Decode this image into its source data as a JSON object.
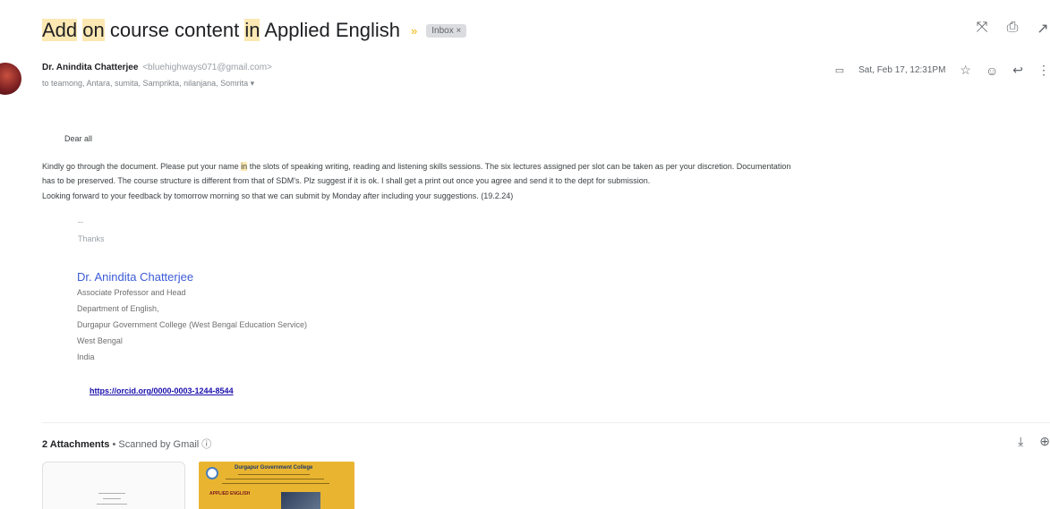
{
  "email": {
    "subject": {
      "part1": "Add",
      "part2": "on",
      "part3": "course content",
      "part4": "in",
      "part5": "Applied English",
      "label": "Inbox ×"
    },
    "sender": {
      "name": "Dr. Anindita Chatterjee",
      "email": "<bluehighways071@gmail.com>",
      "recipients": "to teamong, Antara, sumita, Samprikta, nilanjana, Somrita ▾"
    },
    "meta": {
      "date": "Sat, Feb 17, 12:31PM"
    },
    "body": {
      "greeting": "Dear all",
      "para1_a": "Kindly go through the document. Please put your name",
      "para1_hl": "in",
      "para1_b": "the  slots of speaking writing, reading and listening skills sessions. The six lectures assigned per slot can be taken as per your discretion. Documentation",
      "para2": "has to be preserved. The course structure is different from that of SDM's. Plz suggest if it is ok. I shall get a print out once you agree and send it to the dept for submission.",
      "para3": "Looking forward to your feedback by tomorrow morning so that we can submit by Monday after including your suggestions. (19.2.24)",
      "ellipsis": "--",
      "thanks": "Thanks"
    },
    "signature": {
      "name": "Dr. Anindita Chatterjee",
      "line1": "Associate Professor and Head",
      "line2": "Department of English,",
      "line3": "Durgapur Government College (West Bengal Education Service)",
      "line4": "West Bengal",
      "line5": "India",
      "orcid": "https://orcid.org/0000-0003-1244-8544"
    },
    "attachments": {
      "count_label": "2 Attachments",
      "separator": "•",
      "scan_label": "Scanned by Gmail ⓘ",
      "thumb2_title": "Durgapur Government College",
      "thumb2_subtitle": "APPLIED ENGLISH"
    }
  },
  "icons": {
    "close": "⤧",
    "print": "⎙",
    "open_new": "↗",
    "attachment": "▭",
    "star": "☆",
    "emoji": "☺",
    "reply": "↩",
    "more": "⋮",
    "download": "⤓",
    "add_drive": "⊕",
    "important": "»"
  }
}
